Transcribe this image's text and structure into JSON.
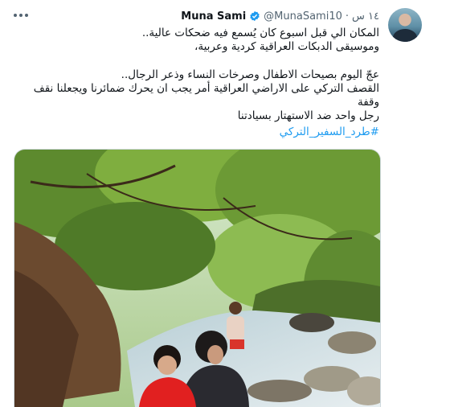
{
  "tweet": {
    "author_name": "Muna Sami",
    "handle": "@MunaSami10",
    "separator": "·",
    "time": "١٤ س",
    "lines": [
      "المكان الي قبل اسبوع كان يُسمع فيه ضحكات عالية..",
      "وموسيقى الدبكات العراقية كردية وعربية،",
      "عجّ اليوم بصيحات الاطفال وصرخات النساء وذعر الرجال..",
      "القصف التركي على الاراضي العراقية أمر يجب ان يحرك ضمائرنا ويجعلنا نقف وقفة",
      "رجل واحد ضد الاستهتار بسيادتنا"
    ],
    "hashtag": "#طرد_السفير_التركي"
  },
  "icons": {
    "more": "more-horizontal-icon",
    "verified": "verified-badge-icon"
  },
  "colors": {
    "link": "#1d9bf0",
    "secondary_text": "#536471",
    "primary_text": "#0f1419"
  }
}
